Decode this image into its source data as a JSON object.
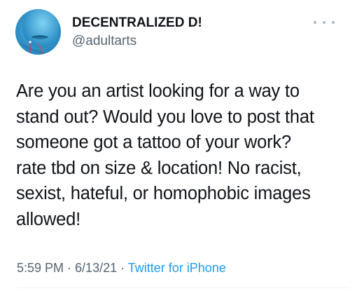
{
  "user": {
    "display_name": "DECENTRALIZED D!",
    "handle": "@adultarts"
  },
  "tweet": {
    "lines": [
      "Are you an artist looking for a way to",
      "stand out? Would you love to post that",
      "someone got a tattoo of your work?",
      "rate tbd on size & location! No racist,",
      "sexist, hateful, or homophobic images",
      "allowed!"
    ]
  },
  "meta": {
    "time": "5:59 PM",
    "separator": " · ",
    "date": "6/13/21",
    "separator2": " · ",
    "source": "Twitter for iPhone"
  },
  "icons": {
    "more": "more-horizontal-icon",
    "avatar": "profile-avatar"
  },
  "colors": {
    "text": "#0f1419",
    "secondary": "#536471",
    "link": "#1d9bf0",
    "avatar_bg": "#3aa3d8"
  }
}
